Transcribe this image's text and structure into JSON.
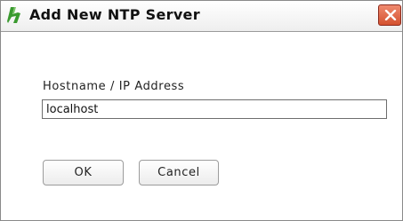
{
  "window": {
    "title": "Add New NTP Server",
    "app_icon": "app-logo-icon",
    "close_icon": "close-icon"
  },
  "form": {
    "hostname_label": "Hostname / IP Address",
    "hostname_value": "localhost"
  },
  "buttons": {
    "ok_label": "OK",
    "cancel_label": "Cancel"
  },
  "colors": {
    "app_icon_green": "#3a9a2f",
    "close_red": "#d4512f"
  }
}
